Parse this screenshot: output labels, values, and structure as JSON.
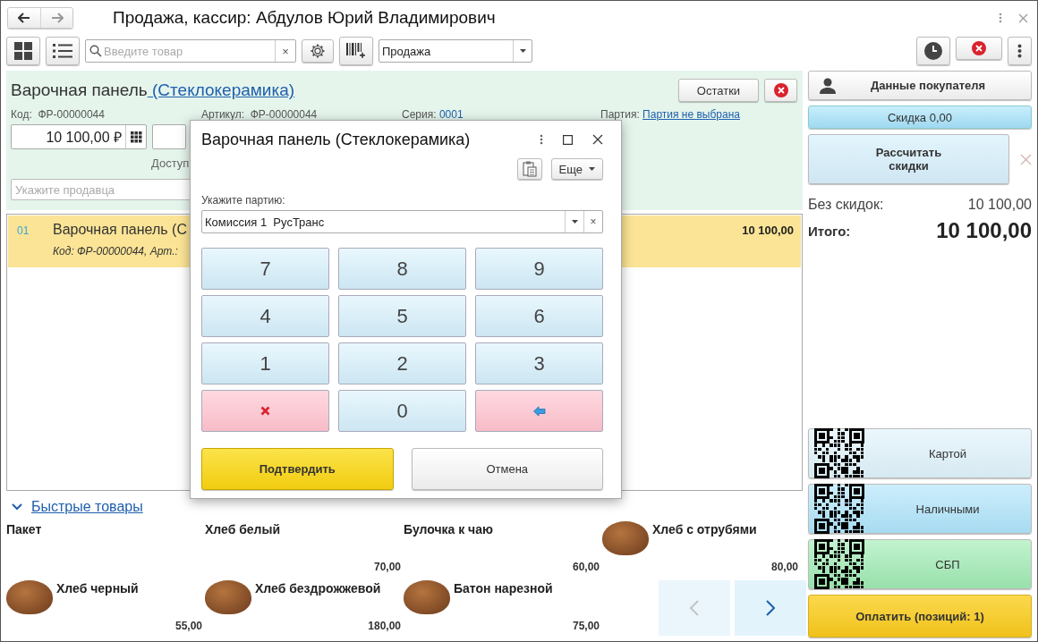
{
  "window": {
    "title": "Продажа, кассир: Абдулов Юрий Владимирович",
    "back_disabled": false,
    "forward_disabled": true
  },
  "toolbar": {
    "search_placeholder": "Введите товар",
    "clear_glyph": "×",
    "operation": "Продажа"
  },
  "product_card": {
    "name": "Варочная панель",
    "name_link": " (Стеклокерамика)",
    "stock_button": "Остатки",
    "code_label": "Код:",
    "code": "ФР-00000044",
    "article_label": "Артикул:",
    "article": "ФР-00000044",
    "series_label": "Серия:",
    "series": "0001",
    "batch_label": "Партия:",
    "batch_link": "Партия не выбрана",
    "price": "10 100,00 ₽",
    "available_label": "Доступ",
    "seller_placeholder": "Укажите продавца"
  },
  "items": [
    {
      "number": "01",
      "name": "Варочная панель (С",
      "details": "Код: ФР-00000044, Арт.:",
      "sum": "10 100,00",
      "selected": true
    }
  ],
  "quick_goods": {
    "title": "Быстрые товары",
    "expanded": true,
    "items": [
      {
        "name": "Пакет",
        "kind": "plain"
      },
      {
        "name": "Хлеб белый",
        "price": "70,00",
        "kind": "plain"
      },
      {
        "name": "Булочка к чаю",
        "price": "60,00",
        "kind": "plain"
      },
      {
        "name": "Хлеб с отрубями",
        "price": "80,00",
        "kind": "photo"
      },
      {
        "name": "Хлеб черный",
        "price": "55,00",
        "kind": "photo"
      },
      {
        "name": "Хлеб бездрожжевой",
        "price": "180,00",
        "kind": "photo"
      },
      {
        "name": "Батон нарезной",
        "price": "75,00",
        "kind": "photo"
      }
    ],
    "pager": [
      {
        "kind": "prev",
        "disabled": true
      },
      {
        "kind": "next",
        "disabled": false
      }
    ]
  },
  "sidebar": {
    "customer_button": "Данные покупателя",
    "discount_button": "Скидка 0,00",
    "calc_button": "Рассчитать скидки",
    "no_discount_label": "Без скидок:",
    "no_discount_value": "10 100,00",
    "total_label": "Итого:",
    "total_value": "10 100,00",
    "payments": [
      {
        "label": "Картой",
        "kind": "card"
      },
      {
        "label": "Наличными",
        "kind": "cash"
      },
      {
        "label": "СБП",
        "kind": "sbp"
      }
    ],
    "pay_button": "Оплатить (позиций: 1)"
  },
  "dialog": {
    "title": "Варочная панель (Стеклокерамика)",
    "more_button": "Еще",
    "batch_label": "Укажите партию:",
    "batch_value": "Комиссия 1  РусТранс",
    "keys": [
      {
        "kind": "digit",
        "label": "7"
      },
      {
        "kind": "digit",
        "label": "8"
      },
      {
        "kind": "digit",
        "label": "9"
      },
      {
        "kind": "digit",
        "label": "4"
      },
      {
        "kind": "digit",
        "label": "5"
      },
      {
        "kind": "digit",
        "label": "6"
      },
      {
        "kind": "digit",
        "label": "1"
      },
      {
        "kind": "digit",
        "label": "2"
      },
      {
        "kind": "digit",
        "label": "3"
      },
      {
        "kind": "clear"
      },
      {
        "kind": "digit",
        "label": "0"
      },
      {
        "kind": "backspace"
      }
    ],
    "confirm_button": "Подтвердить",
    "cancel_button": "Отмена"
  }
}
